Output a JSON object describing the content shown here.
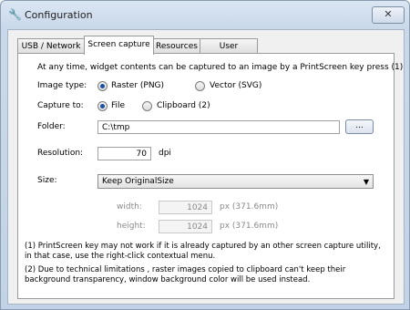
{
  "window": {
    "title": "Configuration",
    "close_glyph": "✕"
  },
  "tabs": [
    {
      "label": "USB / Network"
    },
    {
      "label": "Screen capture"
    },
    {
      "label": "Resources"
    },
    {
      "label": "User Interface"
    }
  ],
  "capture": {
    "intro": "At any time, widget contents can be captured to an image by a PrintScreen key press (1)",
    "image_type": {
      "label": "Image type:",
      "options": [
        "Raster (PNG)",
        "Vector (SVG)"
      ],
      "selected": "Raster (PNG)"
    },
    "capture_to": {
      "label": "Capture to:",
      "options": [
        "File",
        "Clipboard (2)"
      ],
      "selected": "File"
    },
    "folder": {
      "label": "Folder:",
      "value": "C:\\tmp",
      "browse_label": "..."
    },
    "resolution": {
      "label": "Resolution:",
      "value": "70",
      "unit": "dpi"
    },
    "size": {
      "label": "Size:",
      "selected": "Keep OriginalSize"
    },
    "width": {
      "label": "width:",
      "value": "1024",
      "suffix": "px (371.6mm)"
    },
    "height": {
      "label": "height:",
      "value": "1024",
      "suffix": "px (371.6mm)"
    },
    "note1": "(1) PrintScreen key may not work if it is already captured by an other screen capture utility, in that case,  use the right-click contextual  menu.",
    "note2": "(2) Due to technical limitations , raster images copied to clipboard can't keep their background transparency, window background color will be used instead."
  }
}
